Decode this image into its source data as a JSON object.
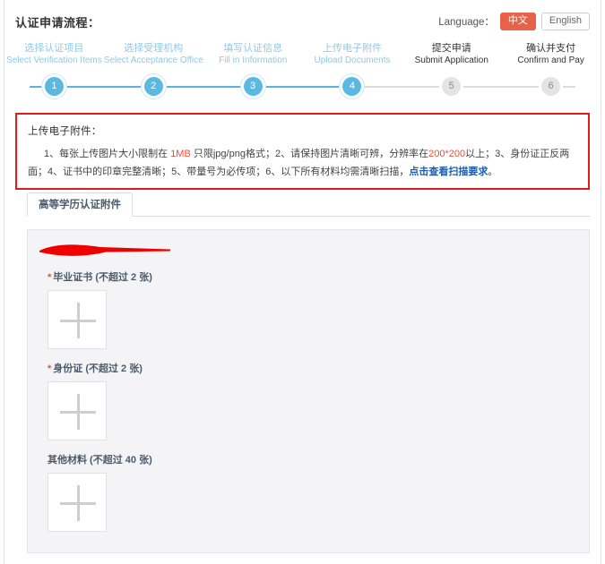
{
  "header": {
    "title": "认证申请流程：",
    "language_label": "Language：",
    "lang_cn": "中文",
    "lang_en": "English",
    "active_lang": "中文",
    "accent_orange": "#e8624a"
  },
  "stepper": {
    "current_step": 4,
    "active_color": "#5bb8e0",
    "inactive_color": "#e4e4e4",
    "steps": [
      {
        "num": "1",
        "cn": "选择认证项目",
        "en": "Select Verification Items",
        "state": "done"
      },
      {
        "num": "2",
        "cn": "选择受理机构",
        "en": "Select Acceptance Office",
        "state": "done"
      },
      {
        "num": "3",
        "cn": "填写认证信息",
        "en": "Fill in Information",
        "state": "done"
      },
      {
        "num": "4",
        "cn": "上传电子附件",
        "en": "Upload Documents",
        "state": "done"
      },
      {
        "num": "5",
        "cn": "提交申请",
        "en": "Submit Application",
        "state": "todo"
      },
      {
        "num": "6",
        "cn": "确认并支付",
        "en": "Confirm and Pay",
        "state": "todo"
      }
    ]
  },
  "notice": {
    "border_color": "#e01b1b",
    "title": "上传电子附件：",
    "seg1": "1、每张上传图片大小限制在 ",
    "hl1": "1MB",
    "seg2": " 只限jpg/png格式；2、请保持图片清晰可辨，分辨率在",
    "hl2": "200*200",
    "seg3": "以上；3、身份证正反两面；4、证书中的印章完整清晰；5、带量号为必传项；6、以下所有材料均需清晰扫描，",
    "link": "点击查看扫描要求",
    "seg4": "。"
  },
  "tab": {
    "label": "高等学历认证附件",
    "active": true
  },
  "upload": {
    "redaction_color": "#ee0000",
    "fields": [
      {
        "required": true,
        "star": "*",
        "label": "毕业证书 (不超过 2 张)",
        "count_max": 2
      },
      {
        "required": true,
        "star": "*",
        "label": "身份证 (不超过 2 张)",
        "count_max": 2
      },
      {
        "required": false,
        "star": "",
        "label": "其他材料 (不超过 40 张)",
        "count_max": 40
      }
    ]
  }
}
